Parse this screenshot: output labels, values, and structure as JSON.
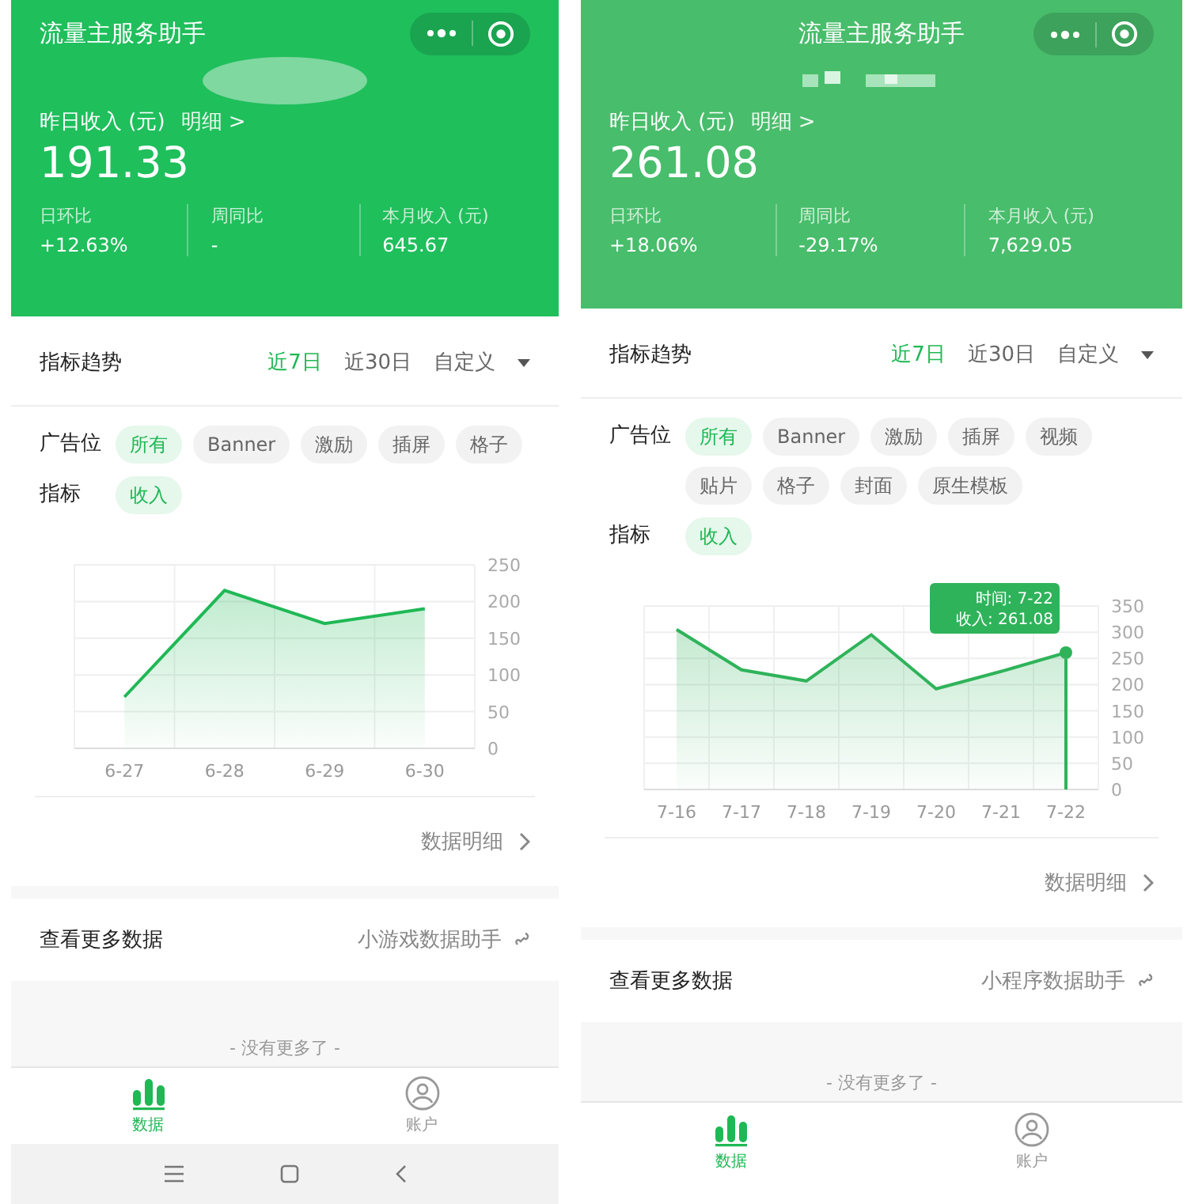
{
  "screens": [
    {
      "kind": "android",
      "title": "流量主服务助手",
      "income_label": "昨日收入 (元)",
      "detail_link": "明细 >",
      "amount": "191.33",
      "stats": [
        {
          "label": "日环比",
          "value": "+12.63%"
        },
        {
          "label": "周同比",
          "value": "-"
        },
        {
          "label": "本月收入 (元)",
          "value": "645.67"
        }
      ],
      "trend": {
        "title": "指标趋势",
        "ranges": [
          {
            "label": "近7日",
            "selected": true
          },
          {
            "label": "近30日",
            "selected": false
          },
          {
            "label": "自定义",
            "selected": false
          }
        ]
      },
      "filters": [
        {
          "label": "广告位",
          "options": [
            {
              "label": "所有",
              "selected": true
            },
            {
              "label": "Banner",
              "selected": false
            },
            {
              "label": "激励",
              "selected": false
            },
            {
              "label": "插屏",
              "selected": false
            },
            {
              "label": "格子",
              "selected": false
            }
          ]
        },
        {
          "label": "指标",
          "options": [
            {
              "label": "收入",
              "selected": true
            }
          ]
        }
      ],
      "chart_data": {
        "type": "area",
        "categories": [
          "6-27",
          "6-28",
          "6-29",
          "6-30"
        ],
        "series": [
          {
            "color": "#1fb855",
            "values": [
              70,
              215,
              170,
              190
            ]
          }
        ],
        "grid": true,
        "ylim": [
          0,
          250
        ],
        "yticks": [
          0,
          50,
          100,
          150,
          200,
          250
        ]
      },
      "data_detail": "数据明细",
      "more": {
        "label": "查看更多数据",
        "link": "小游戏数据助手"
      },
      "end_text": "- 没有更多了 -",
      "tabs": [
        {
          "label": "数据",
          "selected": true,
          "kind": "chart"
        },
        {
          "label": "账户",
          "selected": false,
          "kind": "user"
        }
      ]
    },
    {
      "kind": "ios",
      "title": "流量主服务助手",
      "income_label": "昨日收入 (元)",
      "detail_link": "明细 >",
      "amount": "261.08",
      "stats": [
        {
          "label": "日环比",
          "value": "+18.06%"
        },
        {
          "label": "周同比",
          "value": "-29.17%"
        },
        {
          "label": "本月收入 (元)",
          "value": "7,629.05"
        }
      ],
      "trend": {
        "title": "指标趋势",
        "ranges": [
          {
            "label": "近7日",
            "selected": true
          },
          {
            "label": "近30日",
            "selected": false
          },
          {
            "label": "自定义",
            "selected": false
          }
        ]
      },
      "filters": [
        {
          "label": "广告位",
          "options": [
            {
              "label": "所有",
              "selected": true
            },
            {
              "label": "Banner",
              "selected": false
            },
            {
              "label": "激励",
              "selected": false
            },
            {
              "label": "插屏",
              "selected": false
            },
            {
              "label": "视频",
              "selected": false
            },
            {
              "label": "贴片",
              "selected": false
            },
            {
              "label": "格子",
              "selected": false
            },
            {
              "label": "封面",
              "selected": false
            },
            {
              "label": "原生模板",
              "selected": false
            }
          ]
        },
        {
          "label": "指标",
          "options": [
            {
              "label": "收入",
              "selected": true
            }
          ]
        }
      ],
      "chart_data": {
        "type": "area",
        "categories": [
          "7-16",
          "7-17",
          "7-18",
          "7-19",
          "7-20",
          "7-21",
          "7-22"
        ],
        "series": [
          {
            "color": "#2fb35a",
            "values": [
              305,
              228,
              207,
              295,
              192,
              225,
              261
            ]
          }
        ],
        "grid": true,
        "ylim": [
          0,
          350
        ],
        "yticks": [
          0,
          50,
          100,
          150,
          200,
          250,
          300,
          350
        ],
        "annotations": [
          {
            "x": "7-22",
            "y": 261,
            "text": "时间: 7-22\n收入: 261.08"
          }
        ],
        "ref_lines": [
          {
            "axis": "x",
            "value": "7-22"
          }
        ]
      },
      "data_detail": "数据明细",
      "more": {
        "label": "查看更多数据",
        "link": "小程序数据助手"
      },
      "end_text": "- 没有更多了 -",
      "tabs": [
        {
          "label": "数据",
          "selected": true,
          "kind": "chart"
        },
        {
          "label": "账户",
          "selected": false,
          "kind": "user"
        }
      ]
    }
  ]
}
